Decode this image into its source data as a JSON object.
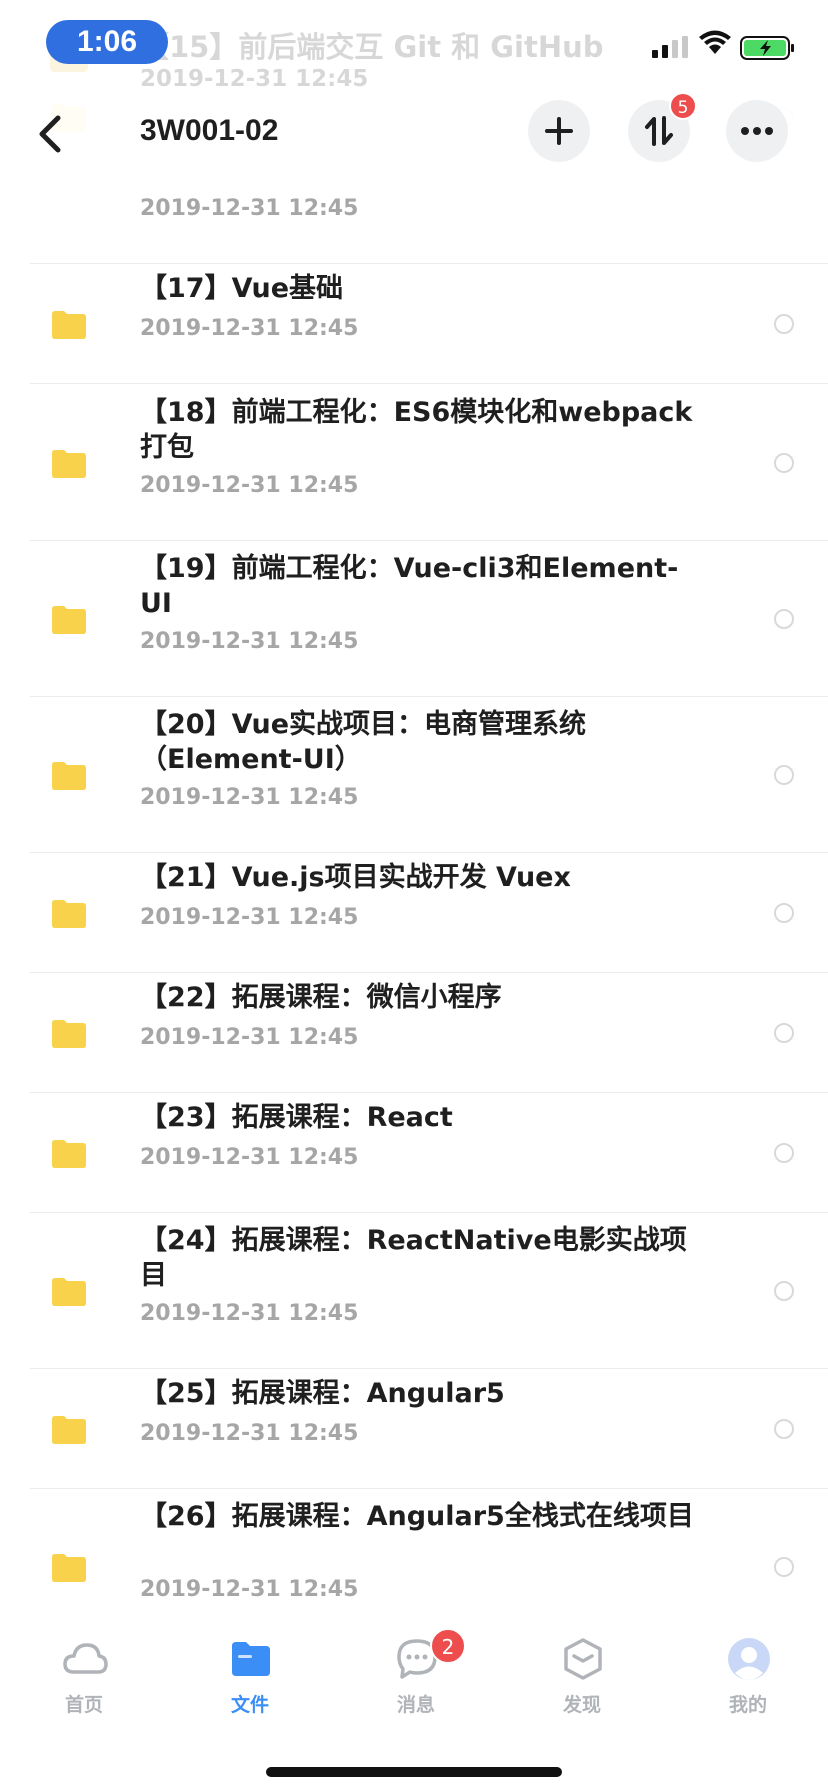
{
  "status_bar": {
    "time": "1:06"
  },
  "ghost_row": {
    "name": "【15】前后端交互 Git 和 GitHub",
    "date": "2019-12-31 12:45"
  },
  "nav": {
    "title": "3W001-02",
    "transfer_badge": "5"
  },
  "files": [
    {
      "name": "",
      "date": "2019-12-31 12:45"
    },
    {
      "name": "【17】Vue基础",
      "date": "2019-12-31 12:45"
    },
    {
      "name": "【18】前端工程化：ES6模块化和webpack打包",
      "date": "2019-12-31 12:45"
    },
    {
      "name": "【19】前端工程化：Vue-cli3和Element-UI",
      "date": "2019-12-31 12:45"
    },
    {
      "name": "【20】Vue实战项目：电商管理系统（Element-UI）",
      "date": "2019-12-31 12:45"
    },
    {
      "name": "【21】Vue.js项目实战开发 Vuex",
      "date": "2019-12-31 12:45"
    },
    {
      "name": "【22】拓展课程：微信小程序",
      "date": "2019-12-31 12:45"
    },
    {
      "name": "【23】拓展课程：React",
      "date": "2019-12-31 12:45"
    },
    {
      "name": "【24】拓展课程：ReactNative电影实战项目",
      "date": "2019-12-31 12:45"
    },
    {
      "name": "【25】拓展课程：Angular5",
      "date": "2019-12-31 12:45"
    },
    {
      "name": "【26】拓展课程：Angular5全栈式在线项目",
      "date": "2019-12-31 12:45"
    }
  ],
  "tabs": [
    {
      "label": "首页",
      "icon": "cloud-icon"
    },
    {
      "label": "文件",
      "icon": "folder-icon"
    },
    {
      "label": "消息",
      "icon": "chat-icon",
      "badge": "2"
    },
    {
      "label": "发现",
      "icon": "cube-icon"
    },
    {
      "label": "我的",
      "icon": "avatar-icon"
    }
  ],
  "colors": {
    "accent": "#3a8ef6",
    "folder": "#f9d24b",
    "badge": "#ee4d4d",
    "time_pill": "#2f6fe0"
  }
}
